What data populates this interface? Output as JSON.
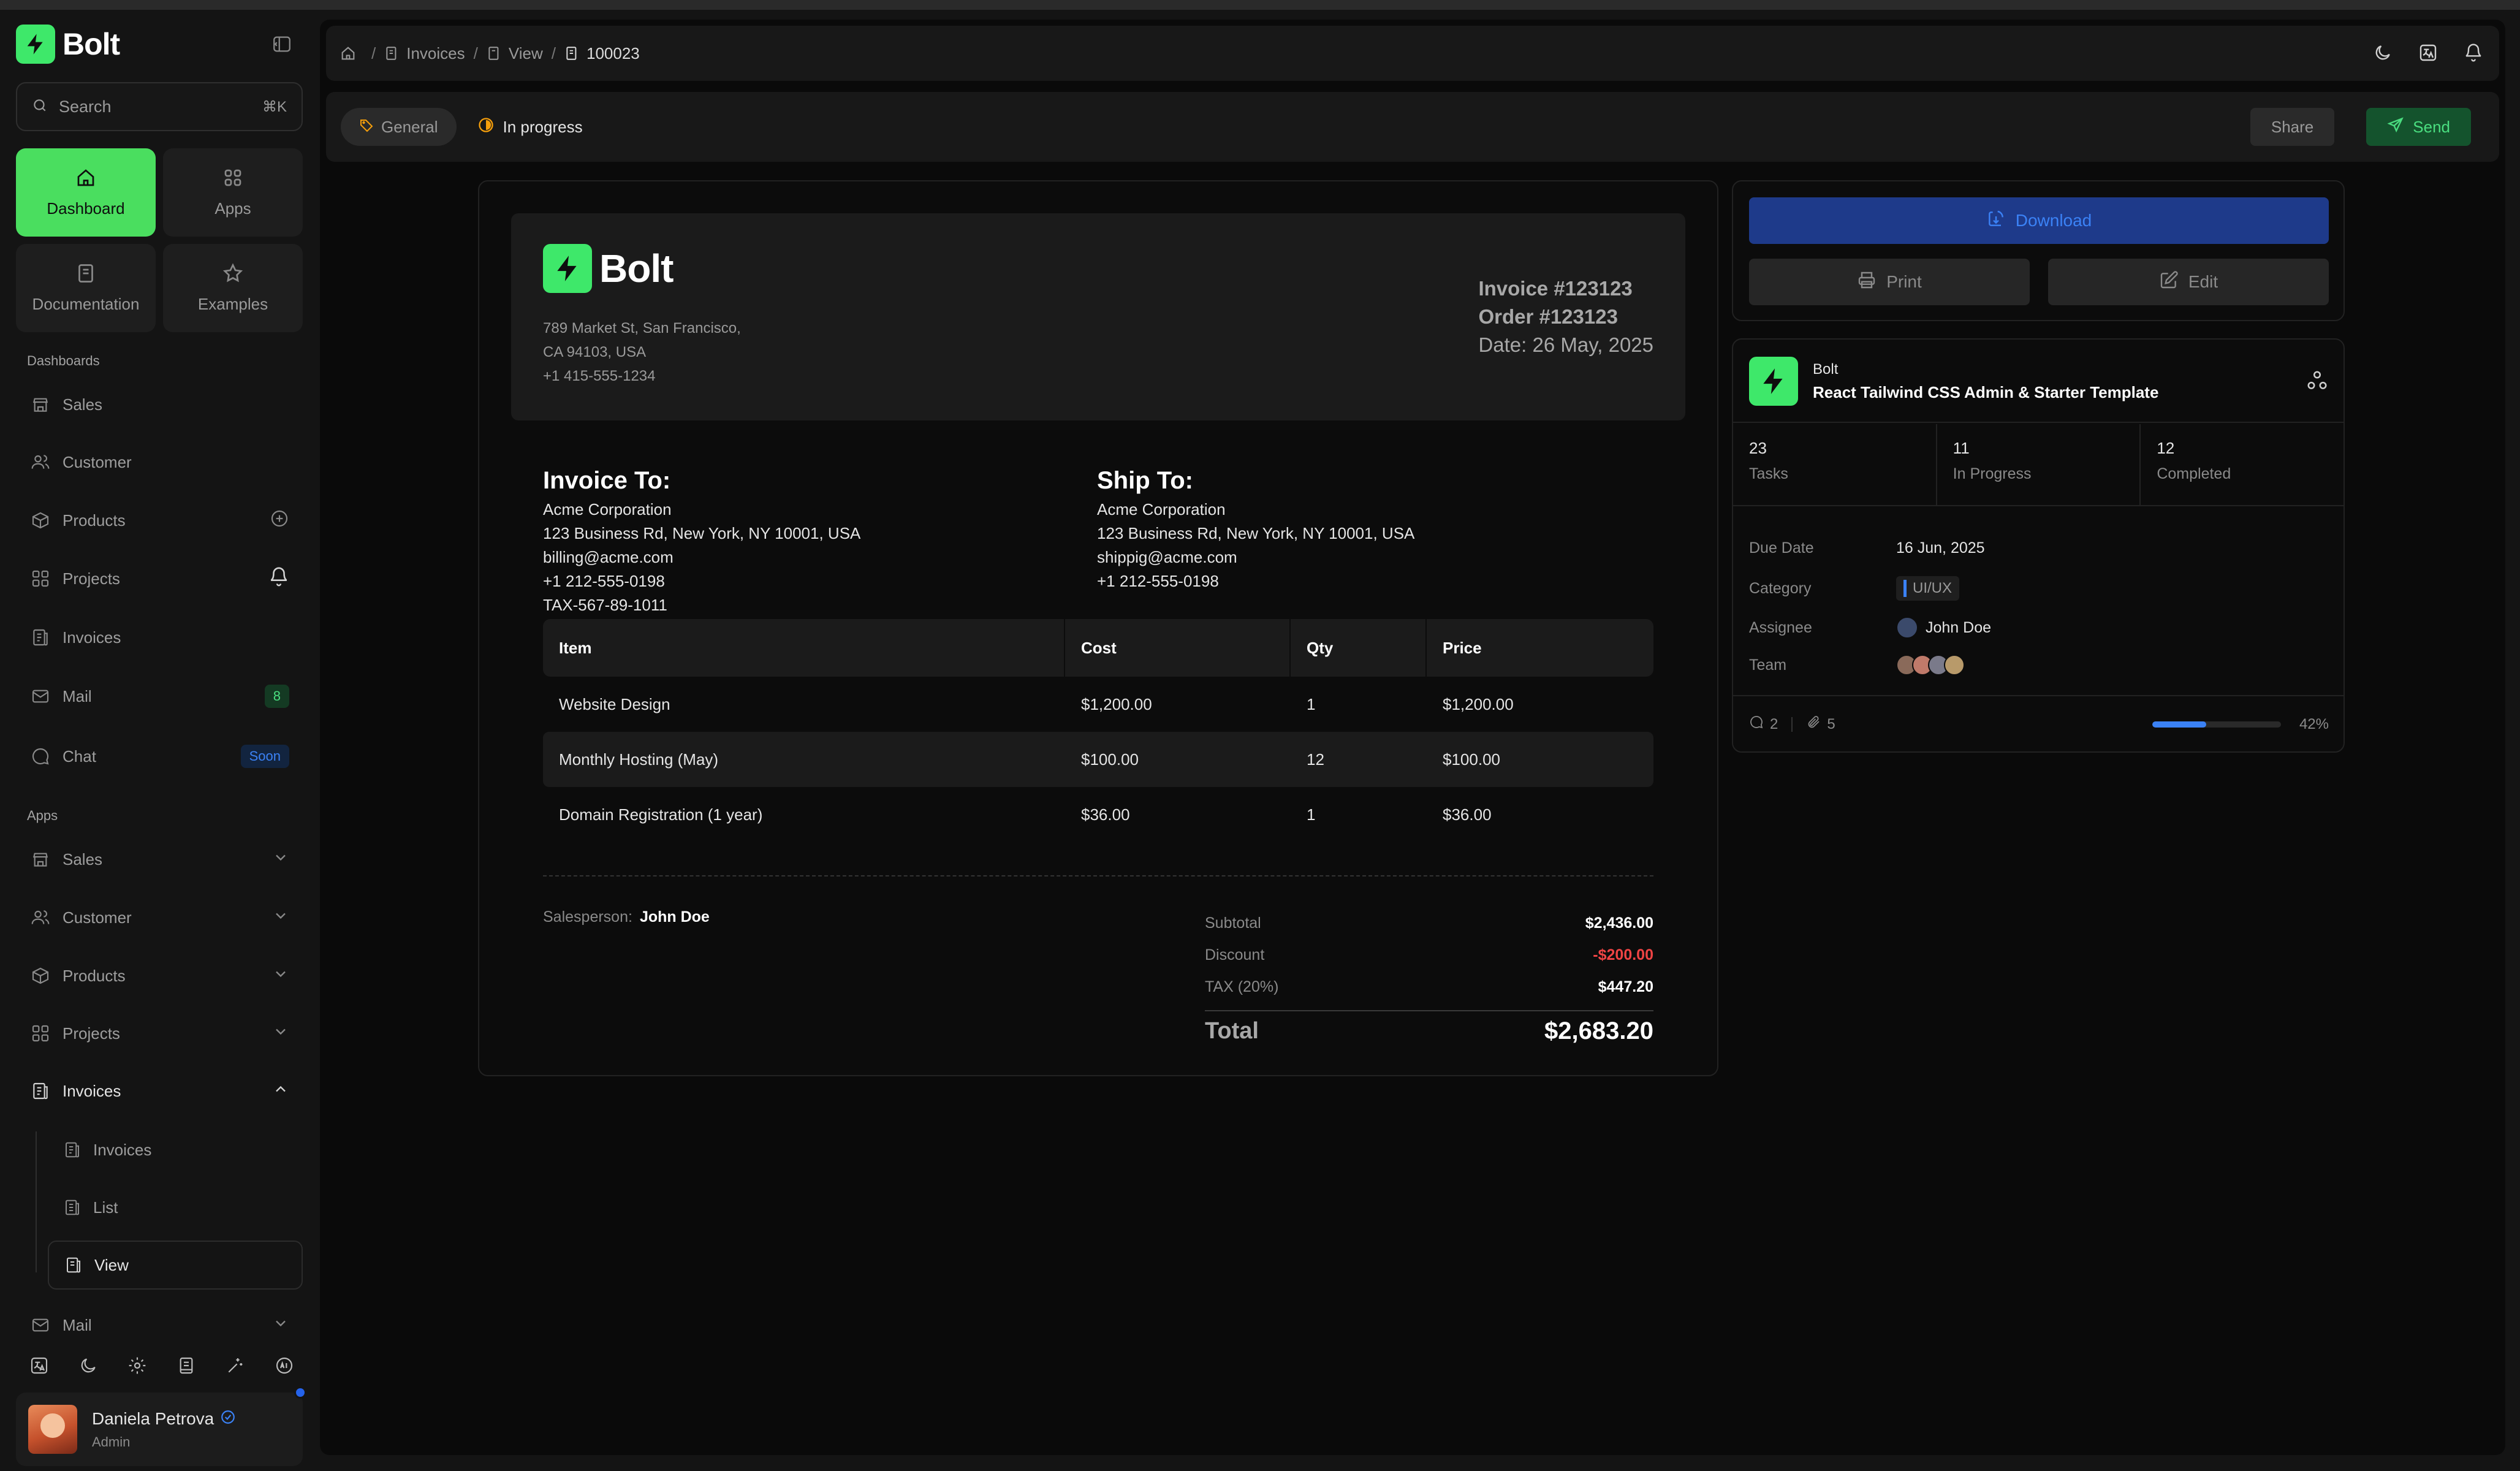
{
  "app": {
    "name": "Bolt"
  },
  "search": {
    "placeholder": "Search",
    "shortcut": "⌘K"
  },
  "tiles": [
    {
      "label": "Dashboard",
      "icon": "home-icon",
      "active": true
    },
    {
      "label": "Apps",
      "icon": "grid-icon"
    },
    {
      "label": "Documentation",
      "icon": "book-icon"
    },
    {
      "label": "Examples",
      "icon": "star-icon"
    }
  ],
  "sidebar": {
    "dashboards_heading": "Dashboards",
    "dashboards": [
      {
        "label": "Sales"
      },
      {
        "label": "Customer"
      },
      {
        "label": "Products"
      },
      {
        "label": "Projects"
      },
      {
        "label": "Invoices"
      },
      {
        "label": "Mail",
        "badge": "8"
      },
      {
        "label": "Chat",
        "badge": "Soon"
      }
    ],
    "apps_heading": "Apps",
    "apps": [
      {
        "label": "Sales"
      },
      {
        "label": "Customer"
      },
      {
        "label": "Products"
      },
      {
        "label": "Projects"
      },
      {
        "label": "Invoices"
      },
      {
        "label": "Mail"
      }
    ],
    "invoices_sub": [
      {
        "label": "Invoices"
      },
      {
        "label": "List"
      },
      {
        "label": "View"
      }
    ]
  },
  "user": {
    "name": "Daniela Petrova",
    "role": "Admin"
  },
  "breadcrumb": {
    "items": [
      "Invoices",
      "View"
    ],
    "current": "100023"
  },
  "toolbar": {
    "tag": "General",
    "status": "In progress",
    "share": "Share",
    "send": "Send"
  },
  "invoice": {
    "brand": "Bolt",
    "address": [
      "789 Market St, San Francisco,",
      "CA 94103, USA",
      "+1 415-555-1234"
    ],
    "invoice_no": "Invoice #123123",
    "order_no": "Order #123123",
    "date": "Date: 26 May, 2025",
    "bill_to": {
      "title": "Invoice To:",
      "lines": [
        "Acme Corporation",
        "123 Business Rd, New York, NY 10001, USA",
        "billing@acme.com",
        "+1 212-555-0198",
        "TAX-567-89-1011"
      ]
    },
    "ship_to": {
      "title": "Ship To:",
      "lines": [
        "Acme Corporation",
        "123 Business Rd, New York, NY 10001, USA",
        "shippig@acme.com",
        "+1 212-555-0198"
      ]
    },
    "columns": [
      "Item",
      "Cost",
      "Qty",
      "Price"
    ],
    "rows": [
      [
        "Website Design",
        "$1,200.00",
        "1",
        "$1,200.00"
      ],
      [
        "Monthly Hosting (May)",
        "$100.00",
        "12",
        "$100.00"
      ],
      [
        "Domain Registration (1 year)",
        "$36.00",
        "1",
        "$36.00"
      ]
    ],
    "salesperson_label": "Salesperson:",
    "salesperson": "John Doe",
    "subtotal_label": "Subtotal",
    "subtotal": "$2,436.00",
    "discount_label": "Discount",
    "discount": "-$200.00",
    "tax_label": "TAX (20%)",
    "tax": "$447.20",
    "total_label": "Total",
    "total": "$2,683.20"
  },
  "actions": {
    "download": "Download",
    "print": "Print",
    "edit": "Edit"
  },
  "project": {
    "name": "Bolt",
    "description": "React Tailwind CSS Admin & Starter Template",
    "stats": [
      {
        "value": "23",
        "label": "Tasks"
      },
      {
        "value": "11",
        "label": "In Progress"
      },
      {
        "value": "12",
        "label": "Completed"
      }
    ],
    "due_label": "Due Date",
    "due": "16 Jun, 2025",
    "category_label": "Category",
    "category": "UI/UX",
    "assignee_label": "Assignee",
    "assignee": "John Doe",
    "team_label": "Team",
    "comments": "2",
    "attachments": "5",
    "progress": 42,
    "progress_label": "42%"
  },
  "colors": {
    "brand": "#3ee86a",
    "accent": "#3b82f6",
    "danger": "#ef4444"
  }
}
